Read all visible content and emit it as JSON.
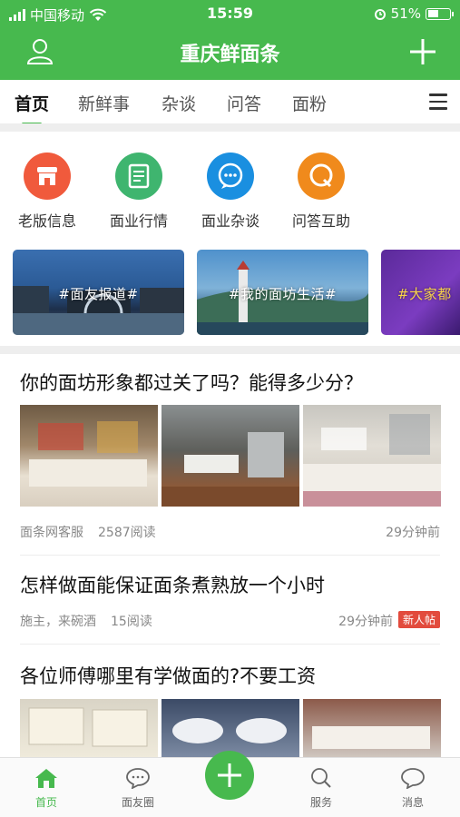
{
  "status": {
    "carrier": "中国移动",
    "time": "15:59",
    "battery": "51%",
    "battery_level": 0.51
  },
  "header": {
    "title": "重庆鲜面条"
  },
  "tabs": [
    "首页",
    "新鲜事",
    "杂谈",
    "问答",
    "面粉"
  ],
  "quick": [
    {
      "label": "老版信息",
      "color": "#f05a3c"
    },
    {
      "label": "面业行情",
      "color": "#3fb56f"
    },
    {
      "label": "面业杂谈",
      "color": "#1a8fe0"
    },
    {
      "label": "问答互助",
      "color": "#f08a1c"
    }
  ],
  "banners": [
    "#面友报道#",
    "#我的面坊生活#",
    "#大家都"
  ],
  "articles": [
    {
      "title": "你的面坊形象都过关了吗？能得多少分？",
      "author": "面条网客服",
      "reads": "2587阅读",
      "time": "29分钟前"
    },
    {
      "title": "怎样做面能保证面条煮熟放一个小时",
      "author": "施主，来碗酒",
      "reads": "15阅读",
      "time": "29分钟前",
      "badge": "新人帖"
    },
    {
      "title": "各位师傅哪里有学做面的?不要工资"
    }
  ],
  "bottom_nav": [
    "首页",
    "面友圈",
    "服务",
    "消息"
  ],
  "colors": {
    "brand": "#47b94e",
    "badge": "#e24b3d"
  }
}
